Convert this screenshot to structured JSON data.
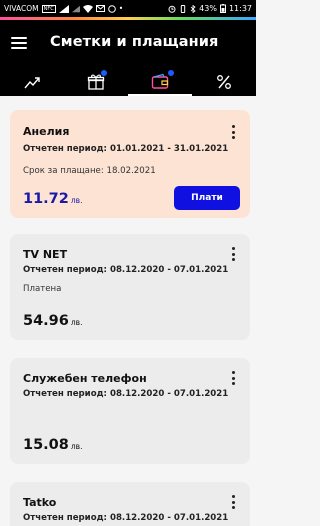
{
  "status_bar": {
    "carrier": "VIVACOM",
    "nfc": "NFC",
    "battery": "43%",
    "time": "11:37"
  },
  "header": {
    "title": "Сметки и плащания"
  },
  "tabs": [
    {
      "icon": "trend-chart-icon",
      "has_badge": false,
      "active": false
    },
    {
      "icon": "gift-icon",
      "has_badge": true,
      "active": false
    },
    {
      "icon": "wallet-icon",
      "has_badge": true,
      "active": true
    },
    {
      "icon": "percent-icon",
      "has_badge": false,
      "active": false
    }
  ],
  "bills": [
    {
      "name": "Анелия",
      "period": "Отчетен период: 01.01.2021 - 31.01.2021",
      "status": "Срок за плащане: 18.02.2021",
      "amount": "11.72",
      "currency": "лв.",
      "pay_label": "Плати"
    },
    {
      "name": "TV NET",
      "period": "Отчетен период: 08.12.2020 - 07.01.2021",
      "status": "Платена",
      "amount": "54.96",
      "currency": "лв."
    },
    {
      "name": "Служебен телефон",
      "period": "Отчетен период: 08.12.2020 - 07.01.2021",
      "status": "",
      "amount": "15.08",
      "currency": "лв."
    },
    {
      "name": "Tatko",
      "period": "Отчетен период: 08.12.2020 - 07.01.2021",
      "status": "",
      "amount": "",
      "currency": ""
    }
  ],
  "colors": {
    "accent_blue": "#1010e0",
    "highlight_card": "#fde3d4",
    "badge": "#1e5bff"
  }
}
